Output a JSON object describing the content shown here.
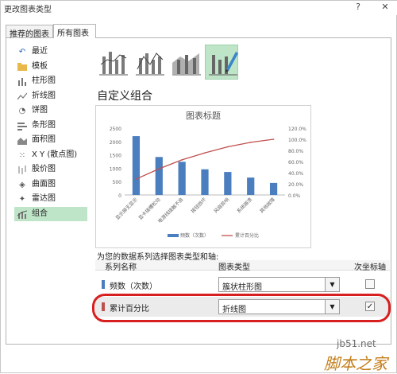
{
  "window": {
    "title": "更改图表类型",
    "help_label": "?",
    "close_label": "✕"
  },
  "tabs": [
    {
      "label": "推荐的图表"
    },
    {
      "label": "所有图表"
    }
  ],
  "sidebar": {
    "items": [
      {
        "label": "最近",
        "icon": "undo-icon"
      },
      {
        "label": "模板",
        "icon": "folder-icon"
      },
      {
        "label": "柱形图",
        "icon": "column-chart-icon"
      },
      {
        "label": "折线图",
        "icon": "line-chart-icon"
      },
      {
        "label": "饼图",
        "icon": "pie-chart-icon"
      },
      {
        "label": "条形图",
        "icon": "bar-chart-icon"
      },
      {
        "label": "面积图",
        "icon": "area-chart-icon"
      },
      {
        "label": "X Y (散点图)",
        "icon": "scatter-chart-icon"
      },
      {
        "label": "股价图",
        "icon": "stock-chart-icon"
      },
      {
        "label": "曲面图",
        "icon": "surface-chart-icon"
      },
      {
        "label": "雷达图",
        "icon": "radar-chart-icon"
      },
      {
        "label": "组合",
        "icon": "combo-chart-icon"
      }
    ],
    "selected_index": 11
  },
  "main": {
    "section_title": "自定义组合",
    "series_instruction": "为您的数据系列选择图表类型和轴:",
    "grid_headers": {
      "name": "系列名称",
      "type": "图表类型",
      "axis": "次坐标轴"
    },
    "series_rows": [
      {
        "name": "频数（次数）",
        "chart_type": "簇状柱形图",
        "secondary_axis": false,
        "color": "#4a7ebf"
      },
      {
        "name": "累计百分比",
        "chart_type": "折线图",
        "secondary_axis": true,
        "color": "#c0504d"
      }
    ]
  },
  "chart_data": {
    "type": "bar",
    "title": "图表标题",
    "categories": [
      "显示屏无显示",
      "显卡插槽松动",
      "电源线接触不良",
      "按钮损坏",
      "风扇异响",
      "系统崩溃",
      "其他故障"
    ],
    "series": [
      {
        "name": "频数（次数）",
        "type": "bar",
        "axis": "primary",
        "color": "#4a7ebf",
        "values": [
          2200,
          1420,
          1240,
          960,
          860,
          650,
          450
        ]
      },
      {
        "name": "累计百分比",
        "type": "line",
        "axis": "secondary",
        "color": "#c0504d",
        "values": [
          28.5,
          47.0,
          63.0,
          75.5,
          86.5,
          94.5,
          100.0
        ]
      }
    ],
    "yticks": [
      "0",
      "500",
      "1000",
      "1500",
      "2000",
      "2500"
    ],
    "ylim": [
      0,
      2500
    ],
    "y2ticks": [
      "0.0%",
      "20.0%",
      "40.0%",
      "60.0%",
      "80.0%",
      "100.0%",
      "120.0%"
    ],
    "y2lim": [
      0,
      120
    ],
    "legend_position": "bottom"
  },
  "watermark": {
    "line1": "jb51.net",
    "line2": "脚本之家"
  }
}
